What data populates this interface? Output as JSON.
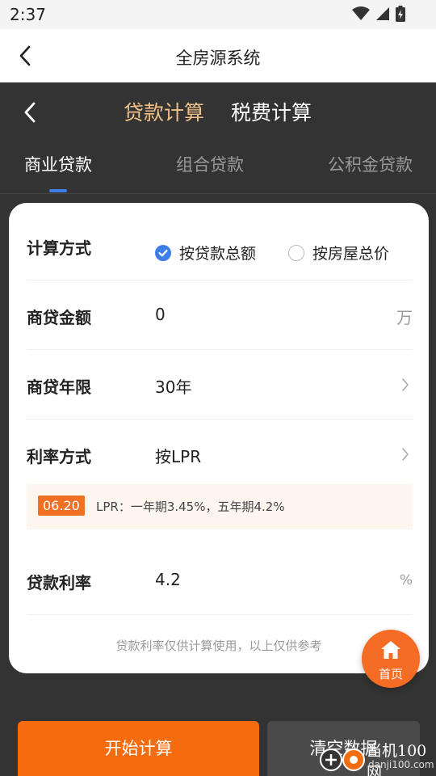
{
  "status_bar": {
    "time": "2:37",
    "icons": [
      "wifi-icon",
      "signal-icon",
      "battery-charging-icon"
    ]
  },
  "app_header": {
    "title": "全房源系统",
    "back_icon": "chevron-left-icon"
  },
  "calc_header": {
    "tabs": [
      {
        "label": "贷款计算",
        "active": true
      },
      {
        "label": "税费计算",
        "active": false
      }
    ],
    "sub_tabs": [
      {
        "label": "商业贷款",
        "active": true
      },
      {
        "label": "组合贷款",
        "active": false
      },
      {
        "label": "公积金贷款",
        "active": false
      }
    ]
  },
  "form": {
    "method": {
      "label": "计算方式",
      "options": [
        {
          "label": "按贷款总额",
          "checked": true
        },
        {
          "label": "按房屋总价",
          "checked": false
        }
      ]
    },
    "amount": {
      "label": "商贷金额",
      "value": "0",
      "unit": "万"
    },
    "term": {
      "label": "商贷年限",
      "value": "30年"
    },
    "rate_method": {
      "label": "利率方式",
      "value": "按LPR"
    },
    "lpr_notice": {
      "date": "06.20",
      "text": "LPR：一年期3.45%，五年期4.2%"
    },
    "rate": {
      "label": "贷款利率",
      "value": "4.2",
      "unit": "%"
    },
    "note": "贷款利率仅供计算使用，以上仅供参考"
  },
  "home_button": {
    "label": "首页"
  },
  "actions": {
    "start_label": "开始计算",
    "clear_label": "清空数据"
  },
  "watermark": {
    "name": "当机100网",
    "url": "danji100.com"
  },
  "colors": {
    "accent_gold": "#f0c188",
    "primary_orange": "#f56c0f",
    "radio_blue": "#3d7ee8",
    "dark_bg": "#333333"
  }
}
